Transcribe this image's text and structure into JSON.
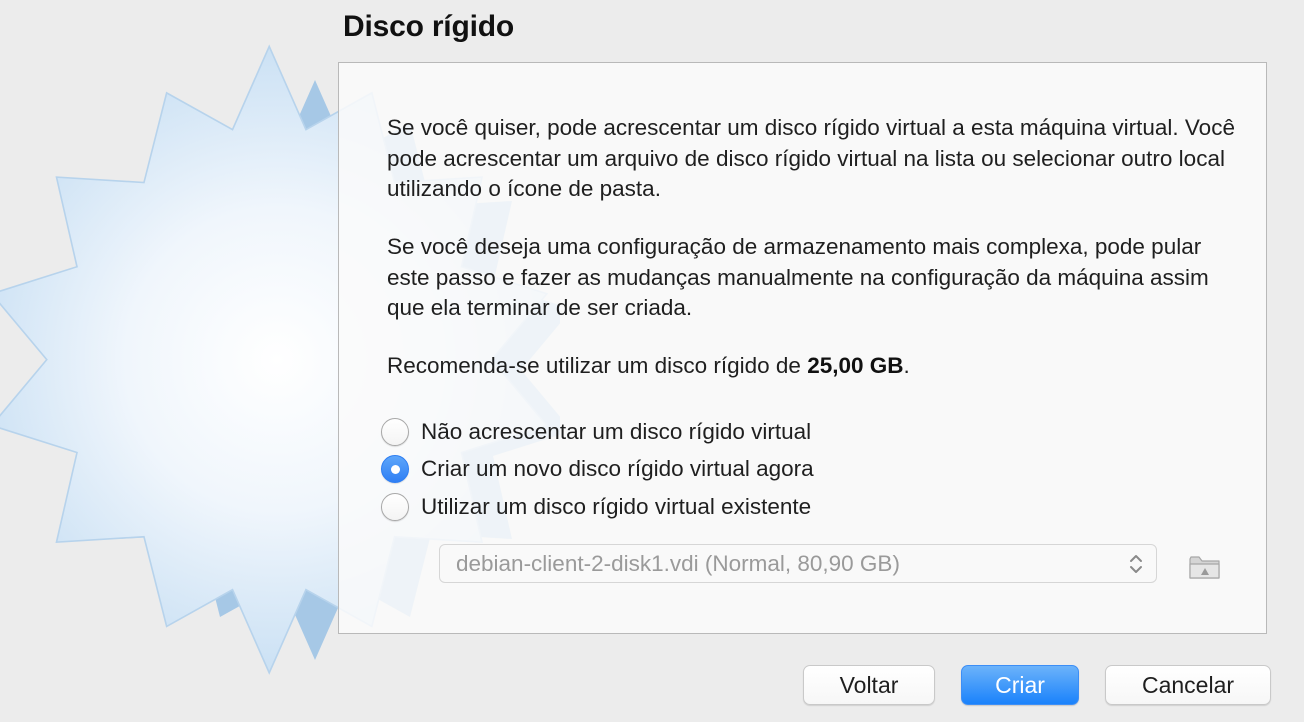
{
  "window": {
    "title": "Disco rígido"
  },
  "content": {
    "paragraph1": "Se você quiser, pode acrescentar um disco rígido virtual a esta máquina virtual. Você pode acrescentar um arquivo de disco rígido virtual na lista ou selecionar outro local utilizando o ícone de pasta.",
    "paragraph2": "Se você deseja uma configuração de armazenamento mais complexa, pode pular este passo e fazer as mudanças manualmente na configuração da máquina assim que ela terminar de ser criada.",
    "recommendation_prefix": "Recomenda-se utilizar um disco rígido de ",
    "recommendation_size": "25,00 GB",
    "recommendation_suffix": "."
  },
  "options": [
    {
      "label": "Não acrescentar um disco rígido virtual",
      "checked": false
    },
    {
      "label": "Criar um novo disco rígido virtual agora",
      "checked": true
    },
    {
      "label": "Utilizar um disco rígido virtual existente",
      "checked": false
    }
  ],
  "disk_select": {
    "value": "debian-client-2-disk1.vdi (Normal, 80,90 GB)",
    "enabled": false,
    "icon": "chevron-up-down-icon"
  },
  "folder_button": {
    "icon": "folder-icon",
    "enabled": false
  },
  "buttons": {
    "back": "Voltar",
    "create": "Criar",
    "cancel": "Cancelar"
  },
  "colors": {
    "accent": "#1a82fb",
    "window_bg": "#ececec",
    "burst": "#c9e1f5"
  }
}
